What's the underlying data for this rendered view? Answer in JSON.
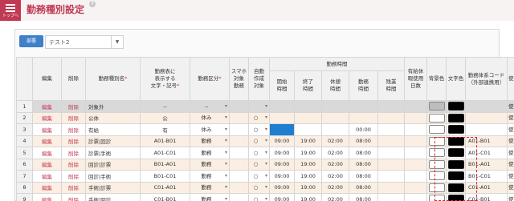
{
  "app": {
    "menu_caption": "トップへ",
    "title": "勤務種別設定",
    "help_icon": "?"
  },
  "department": {
    "badge": "部署",
    "selected": "テスト2"
  },
  "table": {
    "headers": {
      "edit": "編集",
      "delete": "削除",
      "name": "勤務種別名",
      "display": [
        "勤務表に",
        "表示する",
        "文字・記号"
      ],
      "category": "勤務区分",
      "smartphone": [
        "スマホ",
        "対象",
        "勤務"
      ],
      "auto": [
        "自動",
        "作成",
        "対象"
      ],
      "time_group": "勤務時間",
      "start": [
        "開始",
        "時間"
      ],
      "end": [
        "終了",
        "時間"
      ],
      "break": [
        "休憩",
        "時間"
      ],
      "work": [
        "勤務",
        "時間"
      ],
      "overtime": [
        "残業",
        "時間"
      ],
      "paid": [
        "有給休",
        "暇使用",
        "日数"
      ],
      "bg": "背景色",
      "fg": "文字色",
      "code": [
        "勤務体系コード",
        "（外部連携用）"
      ],
      "usage": "使用区分"
    },
    "rows": [
      {
        "no": "1",
        "edit": "編集",
        "del": "削除",
        "name": "対象外",
        "disp": "--",
        "cat": "--",
        "smart": "",
        "auto": "",
        "start": "",
        "end": "",
        "brk": "",
        "work": "",
        "over": "",
        "paid": "",
        "code": "",
        "use": "使用する",
        "style": "grey"
      },
      {
        "no": "2",
        "edit": "編集",
        "del": "削除",
        "name": "公休",
        "disp": "公",
        "cat": "休み",
        "smart": "",
        "auto": "○",
        "start": "",
        "end": "",
        "brk": "",
        "work": "",
        "over": "",
        "paid": "",
        "code": "",
        "use": "使用する",
        "style": "alt"
      },
      {
        "no": "3",
        "edit": "編集",
        "del": "削除",
        "name": "有給",
        "disp": "有",
        "cat": "休み",
        "smart": "",
        "auto": "○",
        "start": "",
        "end": "",
        "brk": "",
        "work": "00:00",
        "over": "",
        "paid": "",
        "code": "",
        "use": "使用する",
        "style": "plain"
      },
      {
        "no": "4",
        "edit": "編集",
        "del": "削除",
        "name": "診票|回診",
        "disp": "A01-B01",
        "cat": "勤務",
        "smart": "",
        "auto": "○",
        "start": "09:00",
        "end": "19:00",
        "brk": "02:00",
        "work": "08:00",
        "over": "",
        "paid": "",
        "code": "A01-B01",
        "use": "使用する",
        "style": "alt"
      },
      {
        "no": "5",
        "edit": "編集",
        "del": "削除",
        "name": "診票|手術",
        "disp": "A01-C01",
        "cat": "勤務",
        "smart": "",
        "auto": "○",
        "start": "09:00",
        "end": "19:00",
        "brk": "02:00",
        "work": "08:00",
        "over": "",
        "paid": "",
        "code": "A01-C01",
        "use": "使用する",
        "style": "plain"
      },
      {
        "no": "6",
        "edit": "編集",
        "del": "削除",
        "name": "回診|診票",
        "disp": "B01-A01",
        "cat": "勤務",
        "smart": "",
        "auto": "○",
        "start": "09:00",
        "end": "19:00",
        "brk": "02:00",
        "work": "08:00",
        "over": "",
        "paid": "",
        "code": "B01-A01",
        "use": "使用する",
        "style": "alt"
      },
      {
        "no": "7",
        "edit": "編集",
        "del": "削除",
        "name": "回診|手術",
        "disp": "B01-C01",
        "cat": "勤務",
        "smart": "",
        "auto": "○",
        "start": "09:00",
        "end": "19:00",
        "brk": "02:00",
        "work": "08:00",
        "over": "",
        "paid": "",
        "code": "B01-C01",
        "use": "使用する",
        "style": "plain"
      },
      {
        "no": "8",
        "edit": "編集",
        "del": "削除",
        "name": "手術|診票",
        "disp": "C01-A01",
        "cat": "勤務",
        "smart": "",
        "auto": "○",
        "start": "09:00",
        "end": "19:00",
        "brk": "02:00",
        "work": "08:00",
        "over": "",
        "paid": "",
        "code": "C01-A01",
        "use": "使用する",
        "style": "alt"
      },
      {
        "no": "9",
        "edit": "編集",
        "del": "削除",
        "name": "手術|回診",
        "disp": "C01-B01",
        "cat": "勤務",
        "smart": "",
        "auto": "○",
        "start": "09:00",
        "end": "19:00",
        "brk": "02:00",
        "work": "08:00",
        "over": "",
        "paid": "",
        "code": "C01-B01",
        "use": "使用する",
        "style": "plain"
      }
    ]
  },
  "colors": {
    "accent": "#c13a53",
    "dept_badge": "#3f80c8",
    "selected_cell": "#1f7fcf",
    "highlight_border": "#d42a2a",
    "alt_row": "#fbeee3"
  }
}
